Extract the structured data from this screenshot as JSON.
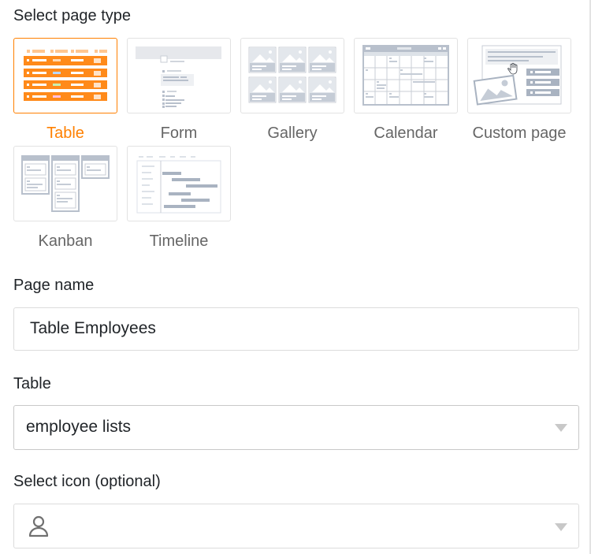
{
  "section_labels": {
    "page_type": "Select page type",
    "page_name": "Page name",
    "table": "Table",
    "icon": "Select icon (optional)"
  },
  "page_types": [
    {
      "id": "table",
      "label": "Table",
      "selected": true
    },
    {
      "id": "form",
      "label": "Form",
      "selected": false
    },
    {
      "id": "gallery",
      "label": "Gallery",
      "selected": false
    },
    {
      "id": "calendar",
      "label": "Calendar",
      "selected": false
    },
    {
      "id": "custom",
      "label": "Custom page",
      "selected": false
    },
    {
      "id": "kanban",
      "label": "Kanban",
      "selected": false
    },
    {
      "id": "timeline",
      "label": "Timeline",
      "selected": false
    }
  ],
  "page_name": {
    "value": "Table Employees"
  },
  "table_select": {
    "value": "employee lists"
  },
  "icon_select": {
    "icon": "user-icon"
  },
  "colors": {
    "accent": "#ff8000",
    "thumb_gray": "#b8c0cc",
    "border": "#dcdcdc"
  }
}
